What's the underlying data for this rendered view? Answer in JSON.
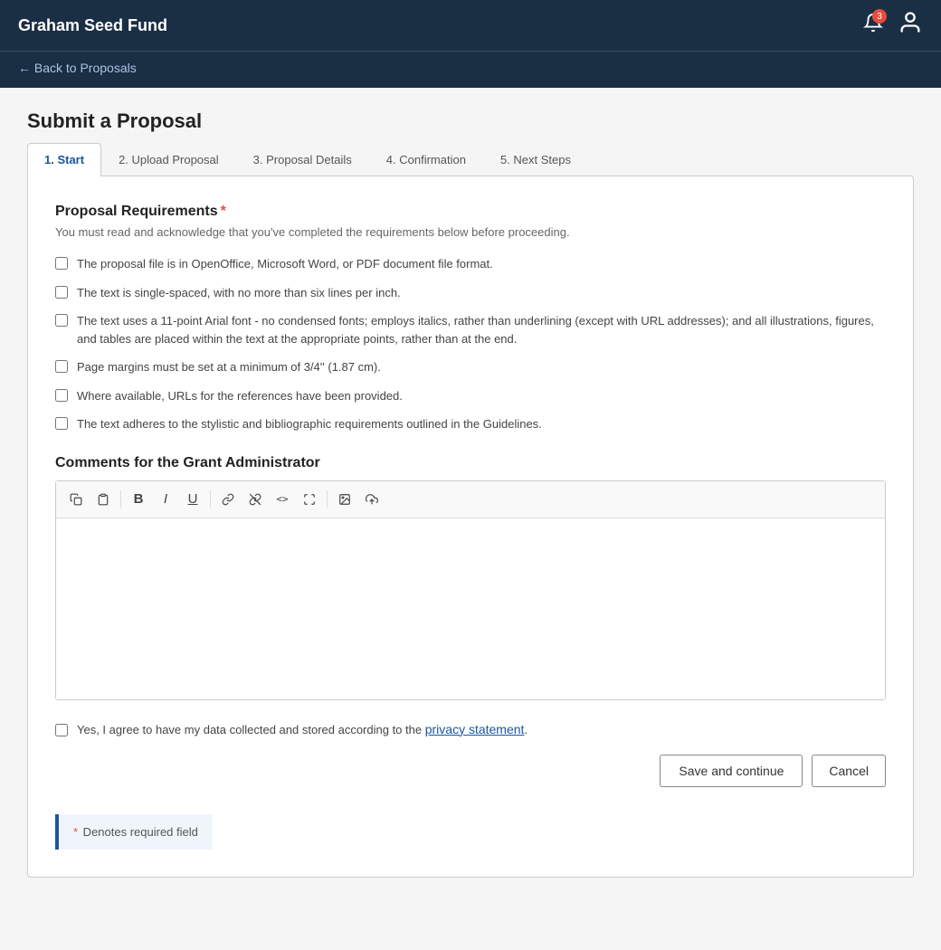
{
  "header": {
    "title": "Graham Seed Fund",
    "notification_count": "3"
  },
  "back_nav": {
    "label": "← Back to Proposals",
    "arrow": "←"
  },
  "page": {
    "title": "Submit a Proposal"
  },
  "tabs": [
    {
      "id": "start",
      "label": "1. Start",
      "active": true
    },
    {
      "id": "upload",
      "label": "2. Upload Proposal",
      "active": false
    },
    {
      "id": "details",
      "label": "3. Proposal Details",
      "active": false
    },
    {
      "id": "confirmation",
      "label": "4. Confirmation",
      "active": false
    },
    {
      "id": "next-steps",
      "label": "5. Next Steps",
      "active": false
    }
  ],
  "form": {
    "requirements_title": "Proposal Requirements",
    "requirements_desc": "You must read and acknowledge that you've completed the requirements below before proceeding.",
    "requirements": [
      {
        "id": "req1",
        "text": "The proposal file is in OpenOffice, Microsoft Word, or PDF document file format."
      },
      {
        "id": "req2",
        "text": "The text is single-spaced, with no more than six lines per inch."
      },
      {
        "id": "req3",
        "text": "The text uses a 11-point Arial font - no condensed fonts; employs italics, rather than underlining (except with URL addresses); and all illustrations, figures, and tables are placed within the text at the appropriate points, rather than at the end."
      },
      {
        "id": "req4",
        "text": "Page margins must be set at a minimum of 3/4'' (1.87 cm)."
      },
      {
        "id": "req5",
        "text": "Where available, URLs for the references have been provided."
      },
      {
        "id": "req6",
        "text": "The text adheres to the stylistic and bibliographic requirements outlined in the Guidelines."
      }
    ],
    "comments_title": "Comments for the Grant Administrator",
    "toolbar_buttons": [
      {
        "id": "copy",
        "symbol": "⧉",
        "title": "Copy"
      },
      {
        "id": "paste",
        "symbol": "📋",
        "title": "Paste"
      },
      {
        "id": "bold",
        "symbol": "B",
        "title": "Bold"
      },
      {
        "id": "italic",
        "symbol": "I",
        "title": "Italic"
      },
      {
        "id": "underline",
        "symbol": "U",
        "title": "Underline"
      },
      {
        "id": "link",
        "symbol": "🔗",
        "title": "Link"
      },
      {
        "id": "unlink",
        "symbol": "⛓",
        "title": "Unlink"
      },
      {
        "id": "code",
        "symbol": "<>",
        "title": "Code"
      },
      {
        "id": "fullscreen",
        "symbol": "⛶",
        "title": "Fullscreen"
      },
      {
        "id": "image",
        "symbol": "🖼",
        "title": "Insert Image"
      },
      {
        "id": "upload",
        "symbol": "⬆",
        "title": "Upload"
      }
    ],
    "privacy_text_before": "Yes, I agree to have my data collected and stored according to the ",
    "privacy_link": "privacy statement",
    "privacy_text_after": ".",
    "save_label": "Save and continue",
    "cancel_label": "Cancel",
    "required_note": "* Denotes required field"
  }
}
